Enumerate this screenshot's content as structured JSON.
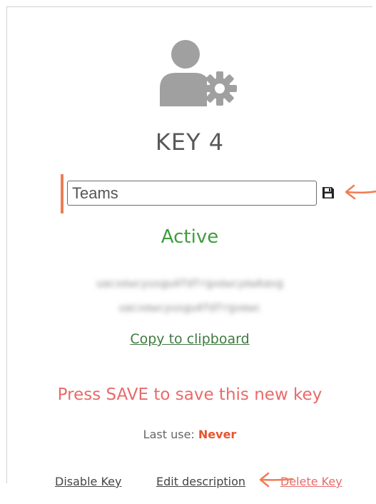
{
  "card": {
    "title": "KEY 4",
    "description": {
      "value": "Teams",
      "placeholder": ""
    },
    "save_icon": "floppy-disk-icon",
    "status": "Active",
    "key_lines": [
      "uacxewcyusgu4fdfrgxewcyewkavg",
      "uacxewcyusgu4fdfrgxewc"
    ],
    "copy_label": "Copy to clipboard",
    "notice": "Press SAVE to save this new key",
    "last_use": {
      "label": "Last use:",
      "value": "Never"
    },
    "actions": {
      "disable": "Disable Key",
      "edit": "Edit description",
      "delete": "Delete Key"
    }
  },
  "annotations": {
    "arrow_color": "#ef7d55"
  },
  "colors": {
    "status_green": "#3f9c3f",
    "notice_red": "#e86a6a",
    "never_orange": "#e8542f",
    "icon_gray": "#a0a0a0"
  }
}
